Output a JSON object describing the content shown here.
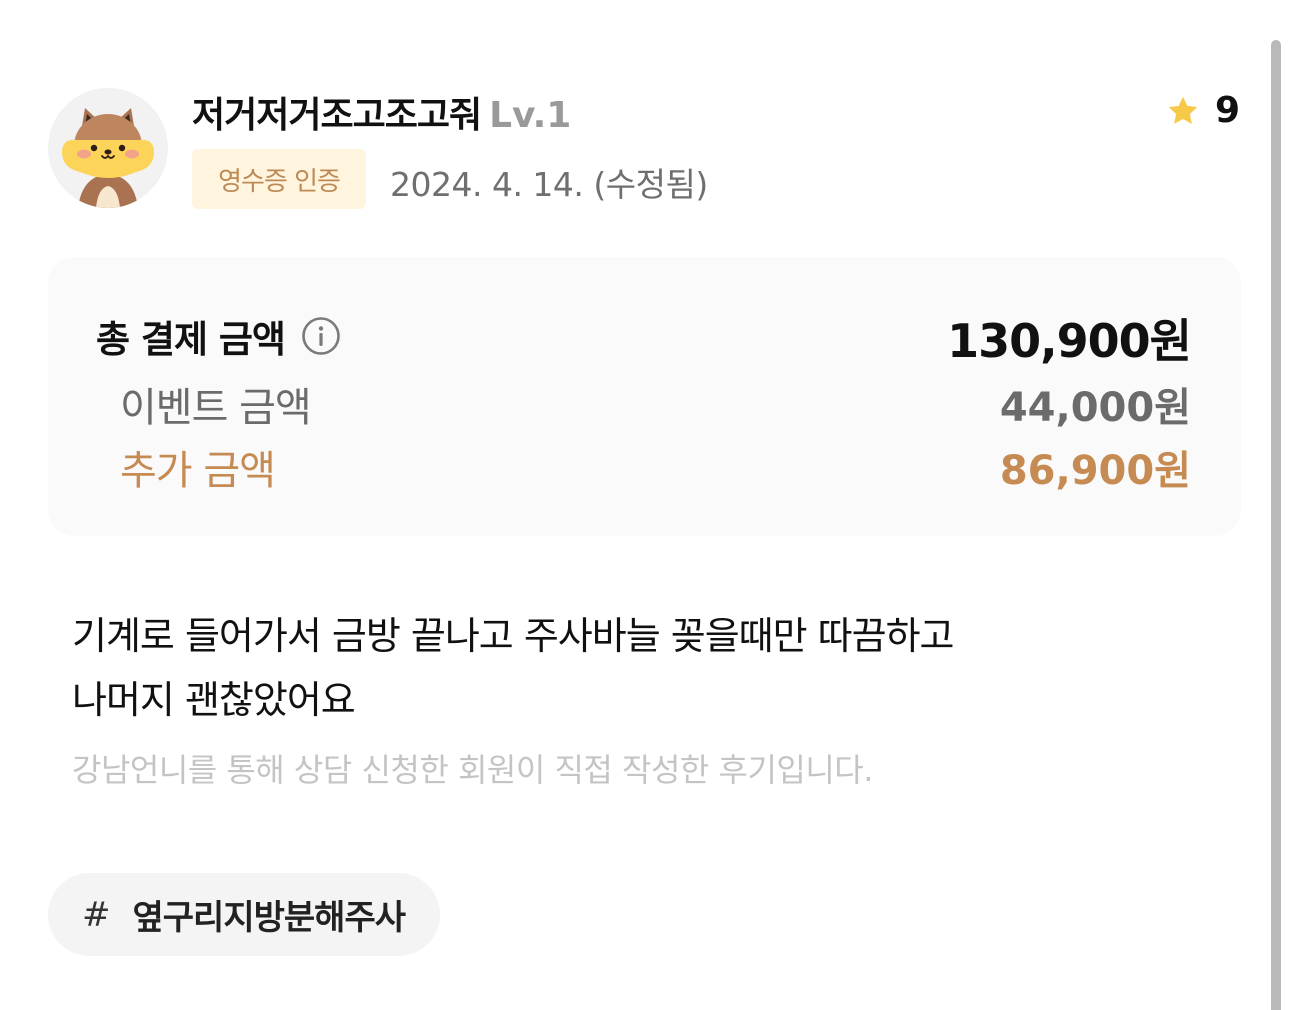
{
  "user": {
    "name": "저거저거조고조고줘",
    "level": "Lv.1",
    "badge": "영수증 인증",
    "date": "2024. 4. 14. (수정됨)"
  },
  "rating": {
    "score": "9",
    "icon": "star-icon",
    "color": "#f7c948"
  },
  "price": {
    "total_label": "총 결제 금액",
    "total_value": "130,900원",
    "event_label": "이벤트 금액",
    "event_value": "44,000원",
    "extra_label": "추가 금액",
    "extra_value": "86,900원",
    "info_icon": "info-icon",
    "accent_color": "#c68b52"
  },
  "review": {
    "lines": [
      "기계로 들어가서 금방 끝나고 주사바늘 꽂을때만 따끔하고",
      "나머지 괜찮았어요"
    ],
    "disclaimer": "강남언니를 통해 상담 신청한 회원이 직접 작성한 후기입니다."
  },
  "tags": [
    {
      "hash": "#",
      "label": "옆구리지방분해주사"
    }
  ]
}
